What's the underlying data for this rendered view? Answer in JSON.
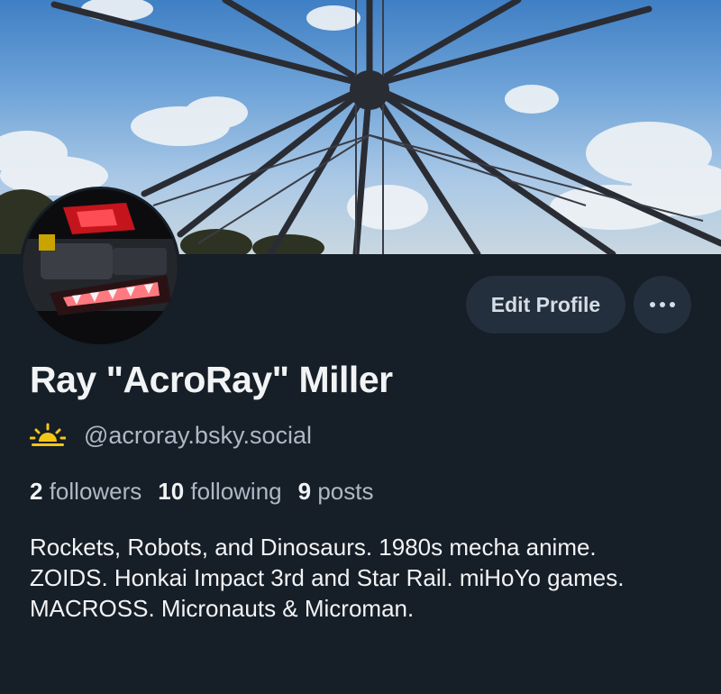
{
  "profile": {
    "display_name": "Ray \"AcroRay\" Miller",
    "handle": "@acroray.bsky.social",
    "followers_count": "2",
    "followers_label": "followers",
    "following_count": "10",
    "following_label": "following",
    "posts_count": "9",
    "posts_label": "posts",
    "bio": "Rockets, Robots, and Dinosaurs. 1980s mecha anime. ZOIDS. Honkai Impact 3rd and Star Rail. miHoYo games. MACROSS. Micronauts & Microman."
  },
  "actions": {
    "edit_label": "Edit Profile",
    "more_icon": "ellipsis-icon"
  },
  "icons": {
    "handle_badge": "sunrise-icon"
  },
  "colors": {
    "background": "#161e27",
    "button_bg": "#232f3c",
    "secondary_text": "#aeb9c6",
    "badge": "#f5c518"
  }
}
